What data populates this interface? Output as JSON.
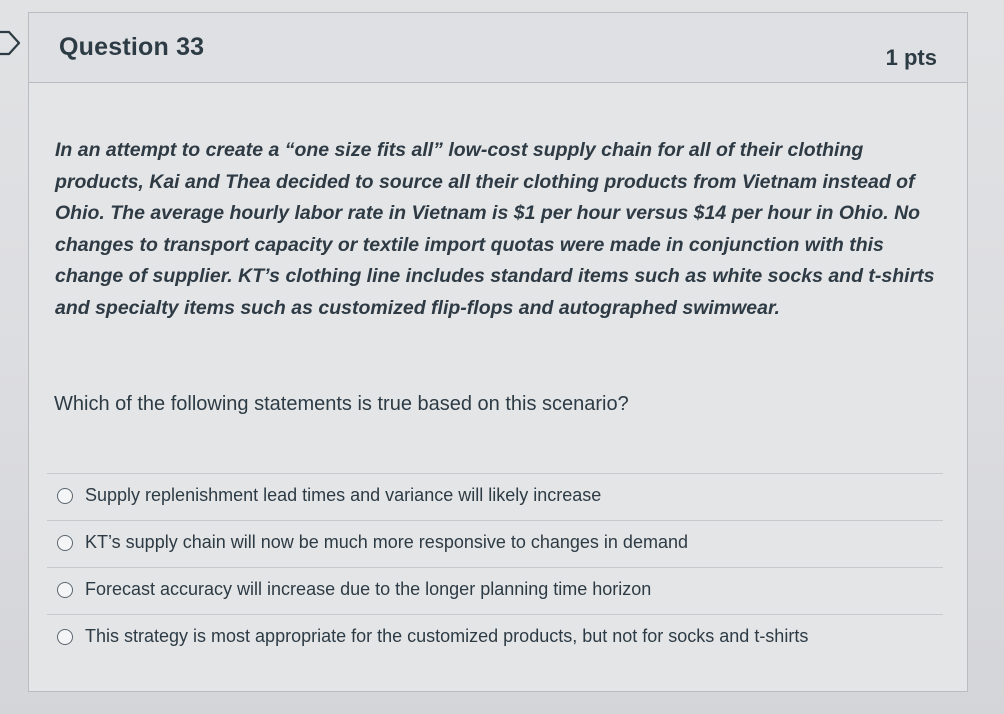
{
  "question": {
    "title": "Question 33",
    "points": "1 pts",
    "scenario": "In an attempt to create a “one size fits all” low-cost supply chain for all of their clothing products, Kai and Thea decided to source all their clothing products from Vietnam instead of Ohio. The average hourly labor rate in Vietnam is $1 per hour versus $14 per hour in Ohio. No changes to transport capacity or textile import quotas were made in conjunction with this change of supplier. KT’s clothing line includes standard items such as white socks and t-shirts and specialty items such as customized flip-flops and autographed swimwear.",
    "prompt": "Which of the following statements is true based on this scenario?",
    "answers": [
      {
        "label": "Supply replenishment lead times and variance will likely increase"
      },
      {
        "label": "KT’s supply chain will now be much more responsive to changes in demand"
      },
      {
        "label": "Forecast accuracy will increase due to the longer planning time horizon"
      },
      {
        "label": "This strategy is most appropriate for the customized products, but not for socks and t-shirts"
      }
    ]
  },
  "icons": {
    "collapse": "chevron-right-icon",
    "radio": "radio-unselected-icon"
  },
  "colors": {
    "text": "#2d3b45",
    "border": "#b9bcc0",
    "header_bg": "#dfe0e3",
    "body_bg": "#e4e5e7"
  }
}
